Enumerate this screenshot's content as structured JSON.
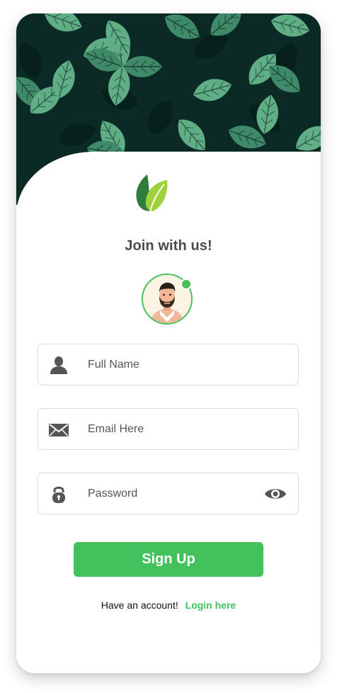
{
  "header": {
    "title": "Join with us!"
  },
  "icons": {
    "logo": "leaf-logo-icon",
    "name": "user-icon",
    "email": "envelope-icon",
    "password": "lock-icon",
    "toggle": "eye-icon"
  },
  "form": {
    "full_name": {
      "placeholder": "Full Name",
      "value": ""
    },
    "email": {
      "placeholder": "Email Here",
      "value": ""
    },
    "password": {
      "placeholder": "Password",
      "value": ""
    }
  },
  "actions": {
    "signup_label": "Sign Up"
  },
  "footer": {
    "prompt": "Have an account!",
    "link_label": "Login here"
  },
  "colors": {
    "accent": "#43c15d",
    "hero_bg": "#0b2a26",
    "leaf": "#5fae86"
  }
}
